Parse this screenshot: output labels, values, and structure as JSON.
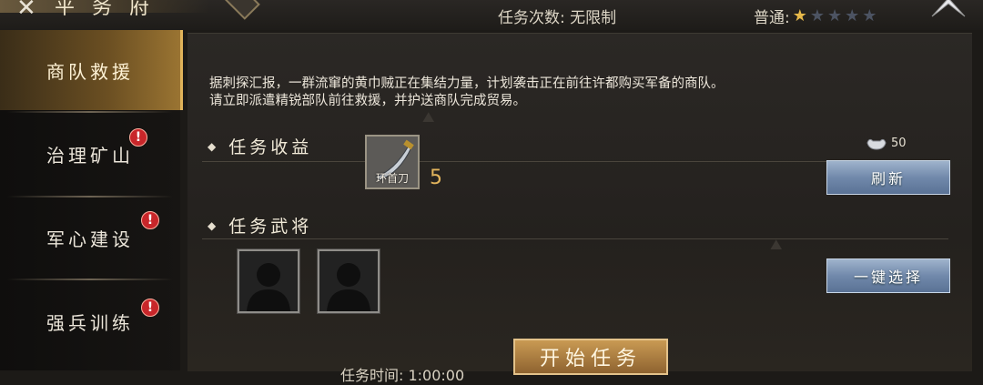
{
  "header": {
    "back_icon": "x-back-icon",
    "title": "平 务 府",
    "task_count": "任务次数: 无限制",
    "difficulty_label": "普通:",
    "difficulty_stars": 1,
    "difficulty_max": 5
  },
  "sidebar": {
    "items": [
      {
        "label": "商队救援",
        "active": true,
        "alert": false
      },
      {
        "label": "治理矿山",
        "active": false,
        "alert": true
      },
      {
        "label": "军心建设",
        "active": false,
        "alert": true
      },
      {
        "label": "强兵训练",
        "active": false,
        "alert": true
      }
    ]
  },
  "main": {
    "description_line1": "据刺探汇报，一群流窜的黄巾贼正在集结力量，计划袭击正在前往许都购买军备的商队。",
    "description_line2": "请立即派遣精锐部队前往救援，并护送商队完成贸易。",
    "reward_title": "任务收益",
    "reward_item_name": "环首刀",
    "reward_item_count": "5",
    "refresh_cost": "50",
    "refresh_label": "刷新",
    "hero_title": "任务武将",
    "auto_select_label": "一键选择",
    "start_label": "开始任务",
    "task_time": "任务时间: 1:00:00"
  },
  "colors": {
    "accent_gold": "#e0b35a",
    "alert_red": "#c8262a",
    "button_blue": "#7189ab"
  }
}
